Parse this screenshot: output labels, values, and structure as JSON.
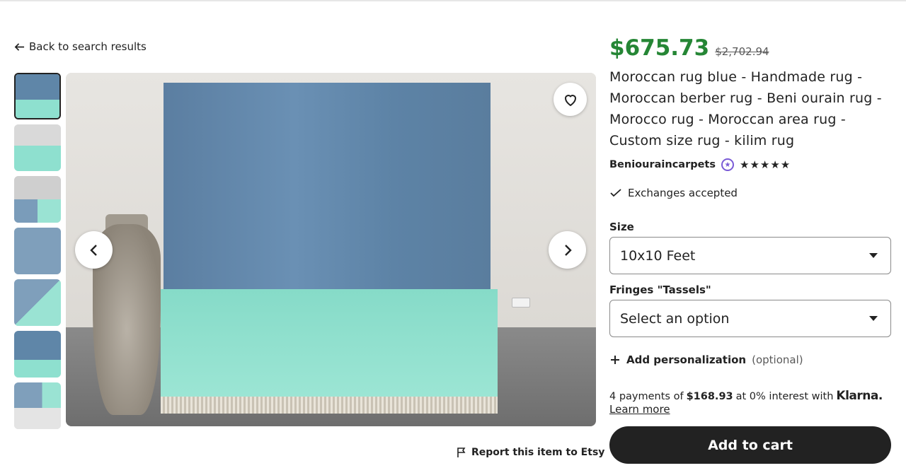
{
  "navigation": {
    "back_label": "Back to search results",
    "back_icon": "arrow-left-icon"
  },
  "gallery": {
    "thumbnail_count": 7,
    "active_thumbnail": 1,
    "favorite_icon": "heart-icon",
    "prev_icon": "chevron-left-icon",
    "next_icon": "chevron-right-icon",
    "report_label": "Report this item to Etsy",
    "report_icon": "flag-icon"
  },
  "product": {
    "price": "$675.73",
    "original_price": "$2,702.94",
    "title": "Moroccan rug blue - Handmade rug - Moroccan berber rug - Beni ourain rug - Morocco rug - Moroccan area rug - Custom size rug - kilim rug",
    "shop_name": "Beniouraincarpets",
    "rating_stars": "★★★★★",
    "rating_value": 5,
    "star_seller_icon": "star-seller-badge-icon",
    "exchanges_text": "Exchanges accepted",
    "exchanges_icon": "check-icon"
  },
  "options": {
    "size_label": "Size",
    "size_value": "10x10 Feet",
    "fringes_label": "Fringes \"Tassels\"",
    "fringes_value": "Select an option"
  },
  "personalization": {
    "label": "Add personalization",
    "optional": "(optional)",
    "icon": "plus-icon"
  },
  "payments": {
    "prefix": "4 payments of",
    "amount": "$168.93",
    "suffix": "at 0% interest with",
    "provider": "Klarna.",
    "learn_more": "Learn more"
  },
  "cart": {
    "button_label": "Add to cart"
  },
  "colors": {
    "price_green": "#258635",
    "button_dark": "#222222",
    "rug_blue": "#5f86a8",
    "rug_mint": "#8ee0cf"
  }
}
